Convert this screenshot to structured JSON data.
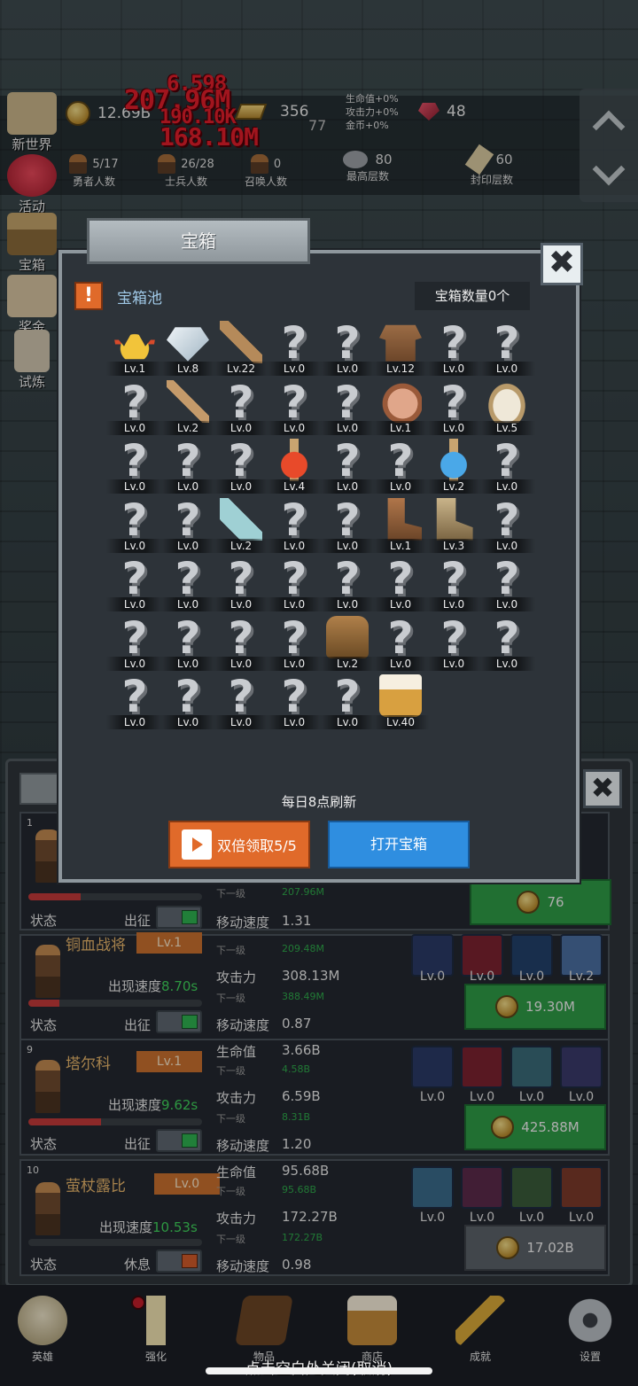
{
  "top": {
    "gold": "12.69B",
    "bars": "356",
    "center_num": "77",
    "ruby": "48",
    "buffs": [
      "生命值+0%",
      "攻击力+0%",
      "金币+0%"
    ],
    "counters": [
      {
        "value": "5/17",
        "label": "勇者人数"
      },
      {
        "value": "26/28",
        "label": "士兵人数"
      },
      {
        "value": "0",
        "label": "召唤人数"
      },
      {
        "value": "80",
        "label": "最高层数"
      },
      {
        "value": "60",
        "label": "封印层数"
      }
    ],
    "damage": [
      "6.598",
      "207.96M",
      "190.10K",
      "168.10M"
    ]
  },
  "left_menu": [
    "新世界",
    "活动",
    "宝箱",
    "奖金",
    "试炼"
  ],
  "modal": {
    "title": "宝箱",
    "close": "✖",
    "alert": "!",
    "pool_title": "宝箱池",
    "pool_count": "宝箱数量0个",
    "refresh": "每日8点刷新",
    "double_btn": "双倍领取5/5",
    "open_btn": "打开宝箱",
    "items": [
      {
        "icon": "crown",
        "lv": "Lv.1"
      },
      {
        "icon": "diamond",
        "lv": "Lv.8"
      },
      {
        "icon": "sword",
        "lv": "Lv.22"
      },
      {
        "icon": "unknown",
        "lv": "Lv.0"
      },
      {
        "icon": "unknown",
        "lv": "Lv.0"
      },
      {
        "icon": "armor",
        "lv": "Lv.12"
      },
      {
        "icon": "unknown",
        "lv": "Lv.0"
      },
      {
        "icon": "unknown",
        "lv": "Lv.0"
      },
      {
        "icon": "unknown",
        "lv": "Lv.0"
      },
      {
        "icon": "dagger",
        "lv": "Lv.2"
      },
      {
        "icon": "unknown",
        "lv": "Lv.0"
      },
      {
        "icon": "unknown",
        "lv": "Lv.0"
      },
      {
        "icon": "unknown",
        "lv": "Lv.0"
      },
      {
        "icon": "meat",
        "lv": "Lv.1"
      },
      {
        "icon": "unknown",
        "lv": "Lv.0"
      },
      {
        "icon": "rice",
        "lv": "Lv.5"
      },
      {
        "icon": "unknown",
        "lv": "Lv.0"
      },
      {
        "icon": "unknown",
        "lv": "Lv.0"
      },
      {
        "icon": "unknown",
        "lv": "Lv.0"
      },
      {
        "icon": "red-potion",
        "lv": "Lv.4"
      },
      {
        "icon": "unknown",
        "lv": "Lv.0"
      },
      {
        "icon": "unknown",
        "lv": "Lv.0"
      },
      {
        "icon": "blue-potion",
        "lv": "Lv.2"
      },
      {
        "icon": "unknown",
        "lv": "Lv.0"
      },
      {
        "icon": "unknown",
        "lv": "Lv.0"
      },
      {
        "icon": "unknown",
        "lv": "Lv.0"
      },
      {
        "icon": "empty-bottle",
        "lv": "Lv.2"
      },
      {
        "icon": "unknown",
        "lv": "Lv.0"
      },
      {
        "icon": "unknown",
        "lv": "Lv.0"
      },
      {
        "icon": "boot",
        "lv": "Lv.1"
      },
      {
        "icon": "boots",
        "lv": "Lv.3"
      },
      {
        "icon": "unknown",
        "lv": "Lv.0"
      },
      {
        "icon": "unknown",
        "lv": "Lv.0"
      },
      {
        "icon": "unknown",
        "lv": "Lv.0"
      },
      {
        "icon": "unknown",
        "lv": "Lv.0"
      },
      {
        "icon": "unknown",
        "lv": "Lv.0"
      },
      {
        "icon": "unknown",
        "lv": "Lv.0"
      },
      {
        "icon": "unknown",
        "lv": "Lv.0"
      },
      {
        "icon": "unknown",
        "lv": "Lv.0"
      },
      {
        "icon": "unknown",
        "lv": "Lv.0"
      },
      {
        "icon": "unknown",
        "lv": "Lv.0"
      },
      {
        "icon": "unknown",
        "lv": "Lv.0"
      },
      {
        "icon": "unknown",
        "lv": "Lv.0"
      },
      {
        "icon": "unknown",
        "lv": "Lv.0"
      },
      {
        "icon": "backpack",
        "lv": "Lv.2"
      },
      {
        "icon": "unknown",
        "lv": "Lv.0"
      },
      {
        "icon": "unknown",
        "lv": "Lv.0"
      },
      {
        "icon": "unknown",
        "lv": "Lv.0"
      },
      {
        "icon": "unknown",
        "lv": "Lv.0"
      },
      {
        "icon": "unknown",
        "lv": "Lv.0"
      },
      {
        "icon": "unknown",
        "lv": "Lv.0"
      },
      {
        "icon": "unknown",
        "lv": "Lv.0"
      },
      {
        "icon": "unknown",
        "lv": "Lv.0"
      },
      {
        "icon": "beer",
        "lv": "Lv.40"
      }
    ]
  },
  "heroes": [
    {
      "num": "1",
      "name": "",
      "lv": "",
      "hp": "",
      "hp_next": "",
      "atk": "",
      "atk_next_label": "下一级",
      "atk_next": "207.96M",
      "speed_label": "移动速度",
      "speed": "1.31",
      "appear": "",
      "state_label": "状态",
      "mode": "出征",
      "on": true,
      "hp_fill": 0.3,
      "skills": [],
      "cost": "76",
      "hp_label": "",
      "atk_label": ""
    },
    {
      "num": "",
      "name": "铜血战将",
      "lv": "Lv.1",
      "hp_label": "",
      "hp": "",
      "hp_next_label": "下一级",
      "hp_next": "209.48M",
      "atk_label": "攻击力",
      "atk": "308.13M",
      "atk_next_label": "下一级",
      "atk_next": "388.49M",
      "speed_label": "移动速度",
      "speed": "0.87",
      "appear_label": "出现速度",
      "appear": "8.70s",
      "state_label": "状态",
      "mode": "出征",
      "on": true,
      "hp_fill": 0.18,
      "skills": [
        {
          "icon": "red-shield-icon",
          "lv": "Lv.0"
        },
        {
          "icon": "claw-icon",
          "lv": "Lv.0"
        },
        {
          "icon": "boot-icon",
          "lv": "Lv.0"
        },
        {
          "icon": "heart-plus-icon",
          "lv": "Lv.2"
        }
      ],
      "cost": "19.30M"
    },
    {
      "num": "9",
      "name": "塔尔科",
      "lv": "Lv.1",
      "hp_label": "生命值",
      "hp": "3.66B",
      "hp_next_label": "下一级",
      "hp_next": "4.58B",
      "atk_label": "攻击力",
      "atk": "6.59B",
      "atk_next_label": "下一级",
      "atk_next": "8.31B",
      "speed_label": "移动速度",
      "speed": "1.20",
      "appear_label": "出现速度",
      "appear": "9.62s",
      "state_label": "状态",
      "mode": "出征",
      "on": true,
      "hp_fill": 0.42,
      "skills": [
        {
          "icon": "round-shield-icon",
          "lv": "Lv.0"
        },
        {
          "icon": "sword-slash-icon",
          "lv": "Lv.0"
        },
        {
          "icon": "green-boot-icon",
          "lv": "Lv.0"
        },
        {
          "icon": "greatsword-icon",
          "lv": "Lv.0"
        }
      ],
      "cost": "425.88M"
    },
    {
      "num": "10",
      "name": "萤杖露比",
      "lv": "Lv.0",
      "hp_label": "生命值",
      "hp": "95.68B",
      "hp_next_label": "下一级",
      "hp_next": "95.68B",
      "atk_label": "攻击力",
      "atk": "172.27B",
      "atk_next_label": "下一级",
      "atk_next": "172.27B",
      "speed_label": "移动速度",
      "speed": "0.98",
      "appear_label": "出现速度",
      "appear": "10.53s",
      "state_label": "状态",
      "mode": "休息",
      "on": false,
      "hp_fill": 0.0,
      "skills": [
        {
          "icon": "leaf-shield-icon",
          "lv": "Lv.0"
        },
        {
          "icon": "dragon-icon",
          "lv": "Lv.0"
        },
        {
          "icon": "dark-boot-icon",
          "lv": "Lv.0"
        },
        {
          "icon": "fire-boot-icon",
          "lv": "Lv.0"
        }
      ],
      "cost": "17.02B"
    }
  ],
  "nav": [
    "英雄",
    "强化",
    "物品",
    "商店",
    "成就",
    "设置"
  ],
  "hint": "点击空白处关闭(取消)"
}
